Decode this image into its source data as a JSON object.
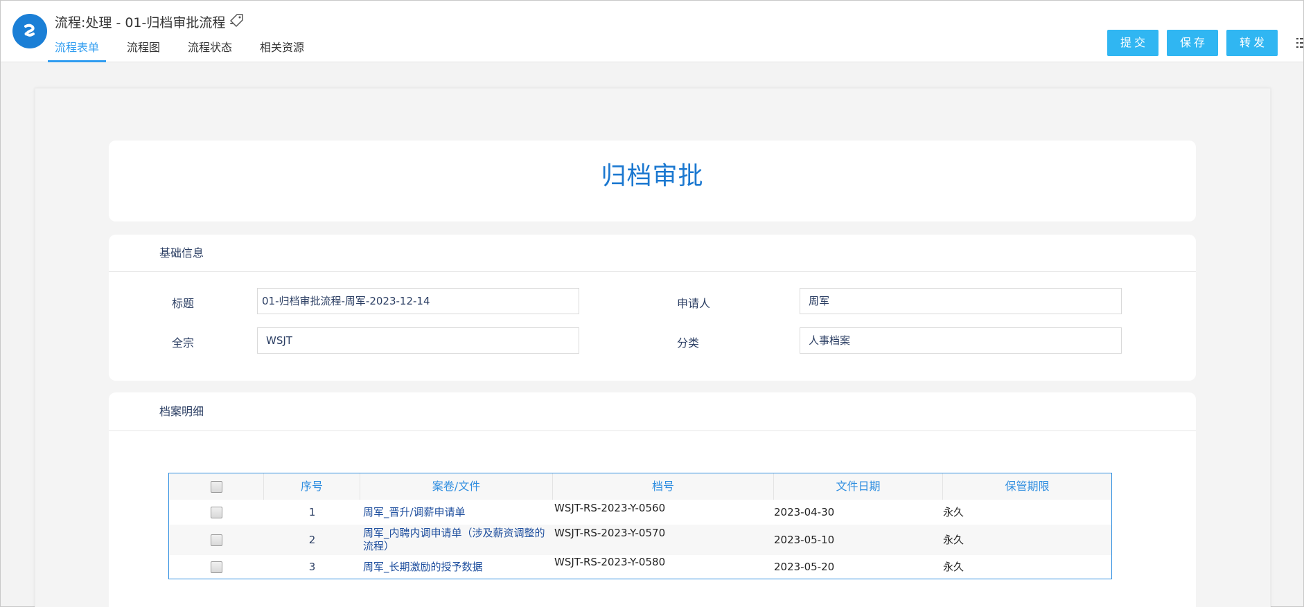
{
  "header": {
    "title": "流程:处理 - 01-归档审批流程 -",
    "tabs": [
      {
        "label": "流程表单",
        "active": true
      },
      {
        "label": "流程图",
        "active": false
      },
      {
        "label": "流程状态",
        "active": false
      },
      {
        "label": "相关资源",
        "active": false
      }
    ],
    "actions": {
      "submit": "提交",
      "save": "保存",
      "forward": "转发"
    }
  },
  "form": {
    "title": "归档审批",
    "basic": {
      "section_title": "基础信息",
      "subject_label": "标题",
      "subject_value": "01-归档审批流程-周军-2023-12-14",
      "applicant_label": "申请人",
      "applicant_value": "周军",
      "fonds_label": "全宗",
      "fonds_value": "WSJT",
      "category_label": "分类",
      "category_value": "人事档案"
    },
    "detail": {
      "section_title": "档案明细",
      "columns": [
        "序号",
        "案卷/文件",
        "档号",
        "文件日期",
        "保管期限"
      ],
      "rows": [
        {
          "no": "1",
          "file": "周军_晋升/调薪申请单",
          "code": "WSJT-RS-2023-Y-0560",
          "date": "2023-04-30",
          "keep": "永久"
        },
        {
          "no": "2",
          "file": "周军_内聘内调申请单（涉及薪资调整的流程）",
          "code": "WSJT-RS-2023-Y-0570",
          "date": "2023-05-10",
          "keep": "永久"
        },
        {
          "no": "3",
          "file": "周军_长期激励的授予数据",
          "code": "WSJT-RS-2023-Y-0580",
          "date": "2023-05-20",
          "keep": "永久"
        }
      ]
    }
  },
  "icons": {
    "logo": "app-logo-icon",
    "tag": "tag-icon",
    "more": "more-menu-icon"
  },
  "colors": {
    "accent": "#2f9cf0",
    "button": "#30b6f2",
    "title": "#1b78d0",
    "logo": "#1b7fd6"
  }
}
